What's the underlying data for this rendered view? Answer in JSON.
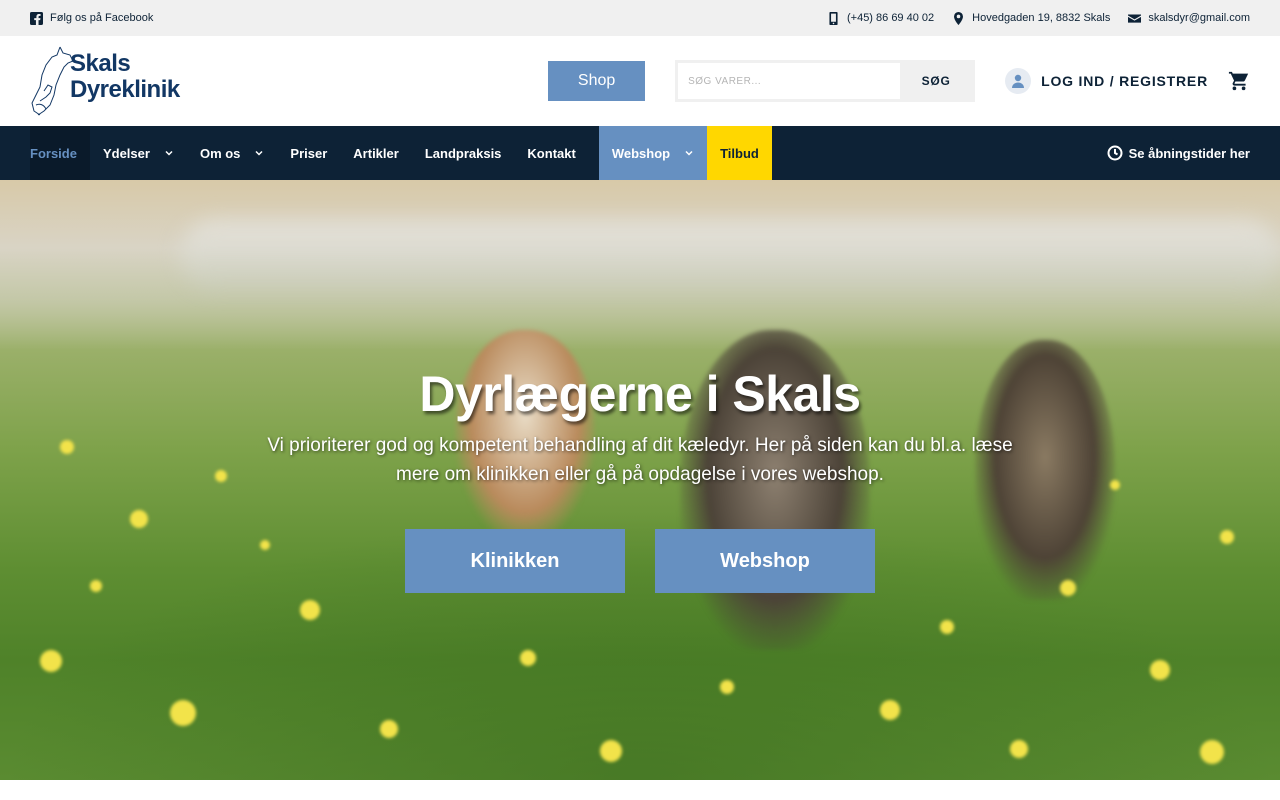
{
  "topbar": {
    "facebook": "Følg os på Facebook",
    "phone": "(+45) 86 69 40 02",
    "address": "Hovedgaden 19, 8832 Skals",
    "email": "skalsdyr@gmail.com"
  },
  "header": {
    "logo_line1": "Skals",
    "logo_line2": "Dyreklinik",
    "shop_label": "Shop",
    "search_placeholder": "SØG VARER...",
    "search_button": "SØG",
    "login_label": "LOG IND / REGISTRER"
  },
  "nav": {
    "items": [
      {
        "label": "Forside"
      },
      {
        "label": "Ydelser"
      },
      {
        "label": "Om os"
      },
      {
        "label": "Priser"
      },
      {
        "label": "Artikler"
      },
      {
        "label": "Landpraksis"
      },
      {
        "label": "Kontakt"
      },
      {
        "label": "Webshop"
      },
      {
        "label": "Tilbud"
      }
    ],
    "hours_label": "Se åbningstider her"
  },
  "hero": {
    "title": "Dyrlægerne i Skals",
    "subtitle": "Vi prioriterer god og kompetent behandling af dit kæledyr. Her på siden kan du bl.a. læse mere om klinikken eller gå på opdagelse i vores webshop.",
    "button_clinic": "Klinikken",
    "button_webshop": "Webshop"
  },
  "colors": {
    "navy": "#0d2236",
    "accent_blue": "#6690c1",
    "tilbud_yellow": "#ffd700"
  }
}
